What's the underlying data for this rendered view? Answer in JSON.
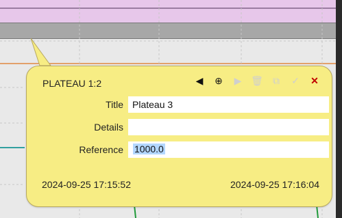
{
  "colors": {
    "top_band": "#e7c7ea",
    "gray_band": "#a7a7a7",
    "popup_bg": "#f7ed84",
    "popup_border": "#b7a860",
    "close": "#c00000",
    "selection": "#b3d7ff"
  },
  "popup": {
    "title": "PLATEAU 1:2",
    "toolbar": {
      "prev_icon": "◀",
      "crosshair_icon": "⊕",
      "next_icon": "▶",
      "delete_icon": "🗑",
      "copy_icon": "⧉",
      "ok_icon": "✓",
      "close_icon": "✕"
    },
    "fields": {
      "title_label": "Title",
      "title_value": "Plateau 3",
      "details_label": "Details",
      "details_value": "",
      "reference_label": "Reference",
      "reference_value": "1000.0"
    },
    "times": {
      "start": "2024-09-25 17:15:52",
      "end": "2024-09-25 17:16:04"
    }
  }
}
